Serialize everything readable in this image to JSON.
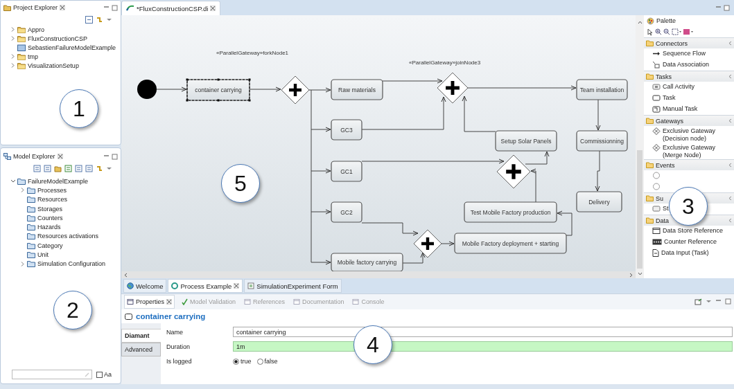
{
  "project_explorer": {
    "title": "Project Explorer",
    "callout": "1",
    "items": [
      {
        "label": "Appro",
        "expandable": true,
        "expanded": false
      },
      {
        "label": "FluxConstructionCSP",
        "expandable": true,
        "expanded": false
      },
      {
        "label": "SebastienFailureModelExample",
        "expandable": false
      },
      {
        "label": "tmp",
        "expandable": true,
        "expanded": false
      },
      {
        "label": "VisualizationSetup",
        "expandable": true,
        "expanded": false
      }
    ]
  },
  "model_explorer": {
    "title": "Model Explorer",
    "callout": "2",
    "items": [
      {
        "label": "FailureModelExample",
        "expandable": true,
        "expanded": true,
        "children": [
          {
            "label": "Processes",
            "expandable": true,
            "expanded": false
          },
          {
            "label": "Resources",
            "expandable": false
          },
          {
            "label": "Storages",
            "expandable": false
          },
          {
            "label": "Counters",
            "expandable": false
          },
          {
            "label": "Hazards",
            "expandable": false
          },
          {
            "label": "Resources activations",
            "expandable": false
          },
          {
            "label": "Category",
            "expandable": false
          },
          {
            "label": "Unit",
            "expandable": false
          },
          {
            "label": "Simulation Configuration",
            "expandable": true,
            "expanded": false
          }
        ]
      }
    ],
    "case_checkbox": {
      "label": "Aa",
      "checked": false
    }
  },
  "editor": {
    "tab": {
      "label": "*FluxConstructionCSP.di",
      "selected": true
    },
    "callout": "5",
    "nodes": [
      {
        "kind": "start"
      },
      {
        "kind": "task",
        "text": "container carrying",
        "selected": true
      },
      {
        "kind": "label",
        "text": "«ParallelGateway»forkNode1"
      },
      {
        "kind": "gateway"
      },
      {
        "kind": "task",
        "text": "Raw materials",
        "selected": false
      },
      {
        "kind": "task",
        "text": "GC3",
        "selected": false
      },
      {
        "kind": "task",
        "text": "GC1",
        "selected": false
      },
      {
        "kind": "task",
        "text": "GC2",
        "selected": false
      },
      {
        "kind": "task",
        "text": "Mobile factory carrying",
        "selected": false
      },
      {
        "kind": "label",
        "text": "«ParallelGateway»joinNode3"
      },
      {
        "kind": "gateway"
      },
      {
        "kind": "task",
        "text": "Team installation",
        "selected": false
      },
      {
        "kind": "task",
        "text": "Commissionning",
        "selected": false
      },
      {
        "kind": "task",
        "text": "Delivery",
        "selected": false
      },
      {
        "kind": "task",
        "text": "Setup Solar Panels",
        "selected": false
      },
      {
        "kind": "gateway"
      },
      {
        "kind": "task",
        "text": "Test Mobile Factory production",
        "selected": false
      },
      {
        "kind": "gateway"
      },
      {
        "kind": "task",
        "text": "Mobile Factory deployment + starting",
        "selected": false
      }
    ]
  },
  "palette": {
    "title": "Palette",
    "callout": "3",
    "groups": [
      {
        "label": "Connectors",
        "items": [
          {
            "kind": "sequence-flow",
            "label": "Sequence Flow"
          },
          {
            "kind": "data-association",
            "label": "Data Association"
          }
        ]
      },
      {
        "label": "Tasks",
        "items": [
          {
            "kind": "call-activity",
            "label": "Call Activity"
          },
          {
            "kind": "task",
            "label": "Task"
          },
          {
            "kind": "manual-task",
            "label": "Manual Task"
          }
        ]
      },
      {
        "label": "Gateways",
        "items": [
          {
            "kind": "exclusive-gateway",
            "label": "Exclusive Gateway (Decision node)"
          },
          {
            "kind": "exclusive-gateway",
            "label": "Exclusive Gateway (Merge Node)"
          }
        ]
      },
      {
        "label": "Events",
        "items": [
          {
            "kind": "event"
          },
          {
            "kind": "event"
          }
        ]
      },
      {
        "label": "Su",
        "items": [
          {
            "kind": "subprocess",
            "label": "St"
          }
        ]
      },
      {
        "label": "Data",
        "items": [
          {
            "kind": "data-store",
            "label": "Data Store Reference"
          },
          {
            "kind": "counter",
            "label": "Counter Reference"
          },
          {
            "kind": "data-input",
            "label": "Data Input (Task)"
          }
        ]
      }
    ]
  },
  "editor_tabs": [
    {
      "label": "Welcome",
      "selected": false,
      "closable": false
    },
    {
      "label": "Process Example",
      "selected": true,
      "closable": true
    },
    {
      "label": "SimulationExperiment Form",
      "selected": false,
      "closable": false
    }
  ],
  "properties": {
    "callout": "4",
    "tabs": [
      {
        "label": "Properties",
        "selected": true,
        "disabled": false
      },
      {
        "label": "Model Validation",
        "selected": false,
        "disabled": true
      },
      {
        "label": "References",
        "selected": false,
        "disabled": true
      },
      {
        "label": "Documentation",
        "selected": false,
        "disabled": true
      },
      {
        "label": "Console",
        "selected": false,
        "disabled": true
      }
    ],
    "title": "container carrying",
    "side_tabs": [
      {
        "label": "Diamant",
        "selected": true
      },
      {
        "label": "Advanced",
        "selected": false
      }
    ],
    "fields": [
      {
        "kind": "text",
        "label": "Name",
        "value": "container carrying",
        "highlighted": false
      },
      {
        "kind": "text",
        "label": "Duration",
        "value": "1m",
        "highlighted": true
      },
      {
        "kind": "radio",
        "label": "Is logged",
        "options": [
          {
            "label": "true",
            "selected": true
          },
          {
            "label": "false",
            "selected": false
          }
        ]
      }
    ]
  }
}
